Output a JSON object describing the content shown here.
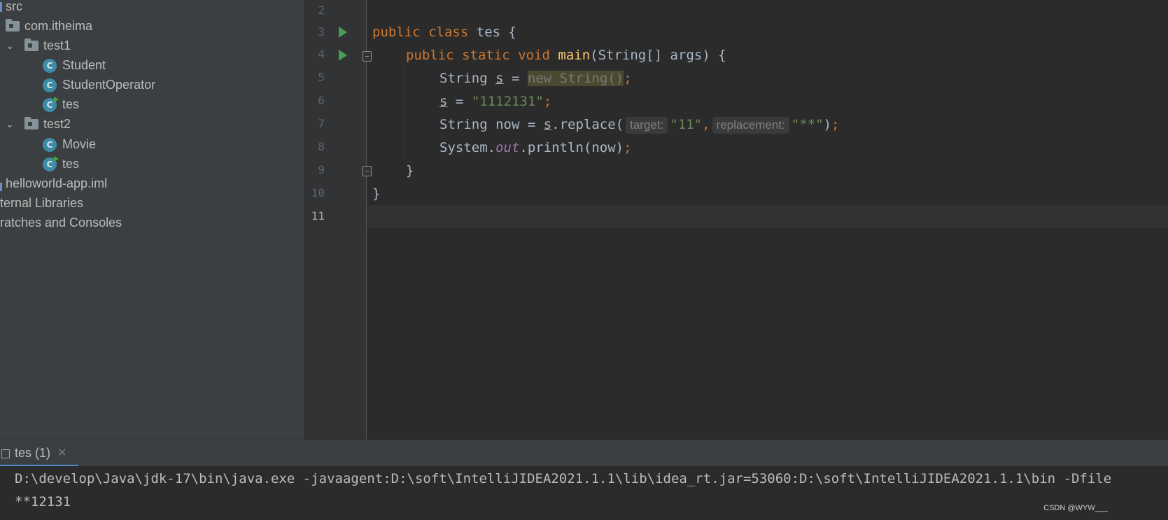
{
  "sidebar": {
    "items": [
      {
        "label": "src",
        "icon": "source-folder-icon"
      },
      {
        "label": "com.itheima",
        "icon": "package-icon"
      },
      {
        "label": "test1",
        "icon": "package-icon",
        "expanded": true
      },
      {
        "label": "Student",
        "icon": "class-icon"
      },
      {
        "label": "StudentOperator",
        "icon": "class-icon"
      },
      {
        "label": "tes",
        "icon": "runnable-class-icon"
      },
      {
        "label": "test2",
        "icon": "package-icon",
        "expanded": true
      },
      {
        "label": "Movie",
        "icon": "class-icon"
      },
      {
        "label": "tes",
        "icon": "runnable-class-icon"
      },
      {
        "label": "helloworld-app.iml",
        "icon": "module-file-icon"
      },
      {
        "label": "ternal Libraries",
        "icon": "library-icon"
      },
      {
        "label": "ratches and Consoles",
        "icon": "scratches-icon"
      }
    ],
    "class_icon_letter": "C"
  },
  "editor": {
    "line_numbers": [
      "2",
      "3",
      "4",
      "5",
      "6",
      "7",
      "8",
      "9",
      "10",
      "11"
    ],
    "current_line": "11",
    "code": {
      "l3": {
        "kw1": "public",
        "kw2": "class",
        "name": "tes",
        "brace": "{"
      },
      "l4": {
        "kw1": "public",
        "kw2": "static",
        "kw3": "void",
        "method": "main",
        "params": "(String[] args) {"
      },
      "l5": {
        "type": "String",
        "var": "s",
        "eq": "=",
        "expr": "new String()",
        "semi": ";"
      },
      "l6": {
        "var": "s",
        "eq": "=",
        "str": "\"1112131\"",
        "semi": ";"
      },
      "l7": {
        "pre": "String now = ",
        "var": "s",
        "call": ".replace(",
        "hint1": "target:",
        "arg1": "\"11\"",
        "comma": ",",
        "hint2": "replacement:",
        "arg2": "\"**\"",
        "close": ")",
        "semi": ";"
      },
      "l8": {
        "obj": "System.",
        "field": "out",
        "call": ".println(now)",
        "semi": ";"
      },
      "l9": {
        "brace": "}"
      },
      "l10": {
        "brace": "}"
      }
    }
  },
  "run_panel": {
    "tab_label": "tes (1)",
    "console_lines": [
      "D:\\develop\\Java\\jdk-17\\bin\\java.exe -javaagent:D:\\soft\\IntelliJIDEA2021.1.1\\lib\\idea_rt.jar=53060:D:\\soft\\IntelliJIDEA2021.1.1\\bin -Dfile",
      "**12131"
    ]
  },
  "watermark": "CSDN @WYW___"
}
